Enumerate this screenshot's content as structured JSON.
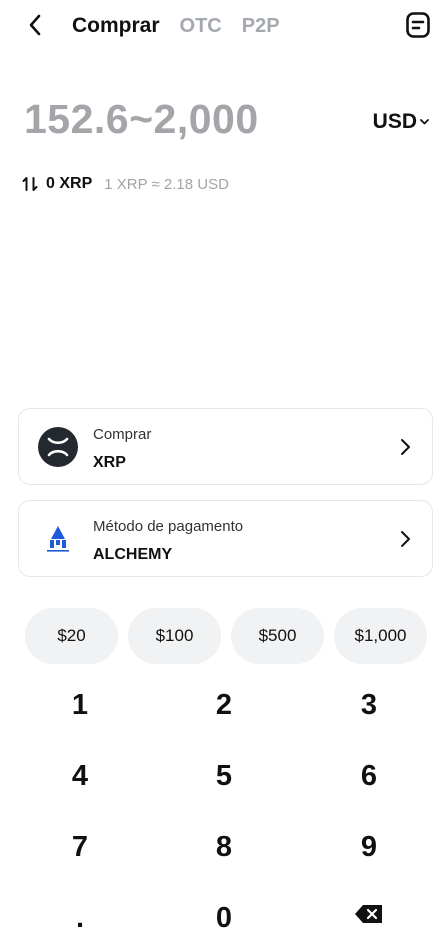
{
  "header": {
    "back_icon": "chevron-left-icon",
    "tabs": [
      {
        "label": "Comprar",
        "active": true
      },
      {
        "label": "OTC",
        "active": false
      },
      {
        "label": "P2P",
        "active": false
      }
    ],
    "orders_icon": "document-icon"
  },
  "amount": {
    "placeholder": "152.6~2,000",
    "currency": "USD"
  },
  "conversion": {
    "icon": "swap-vertical-icon",
    "amount": "0 XRP",
    "rate": "1 XRP ≈ 2.18 USD"
  },
  "buy_card": {
    "label": "Comprar",
    "value": "XRP",
    "icon": "xrp-logo-icon"
  },
  "payment_card": {
    "label": "Método de pagamento",
    "value": "ALCHEMY",
    "icon": "alchemy-pay-logo-icon"
  },
  "quick_amounts": [
    "$20",
    "$100",
    "$500",
    "$1,000"
  ],
  "keypad": [
    "1",
    "2",
    "3",
    "4",
    "5",
    "6",
    "7",
    "8",
    "9",
    ".",
    "0"
  ],
  "colors": {
    "text": "#111111",
    "muted": "#a3a5a8",
    "chip_bg": "#f1f2f4",
    "card_border": "#e6e7ea",
    "alchemy_blue": "#1e5bd6"
  }
}
